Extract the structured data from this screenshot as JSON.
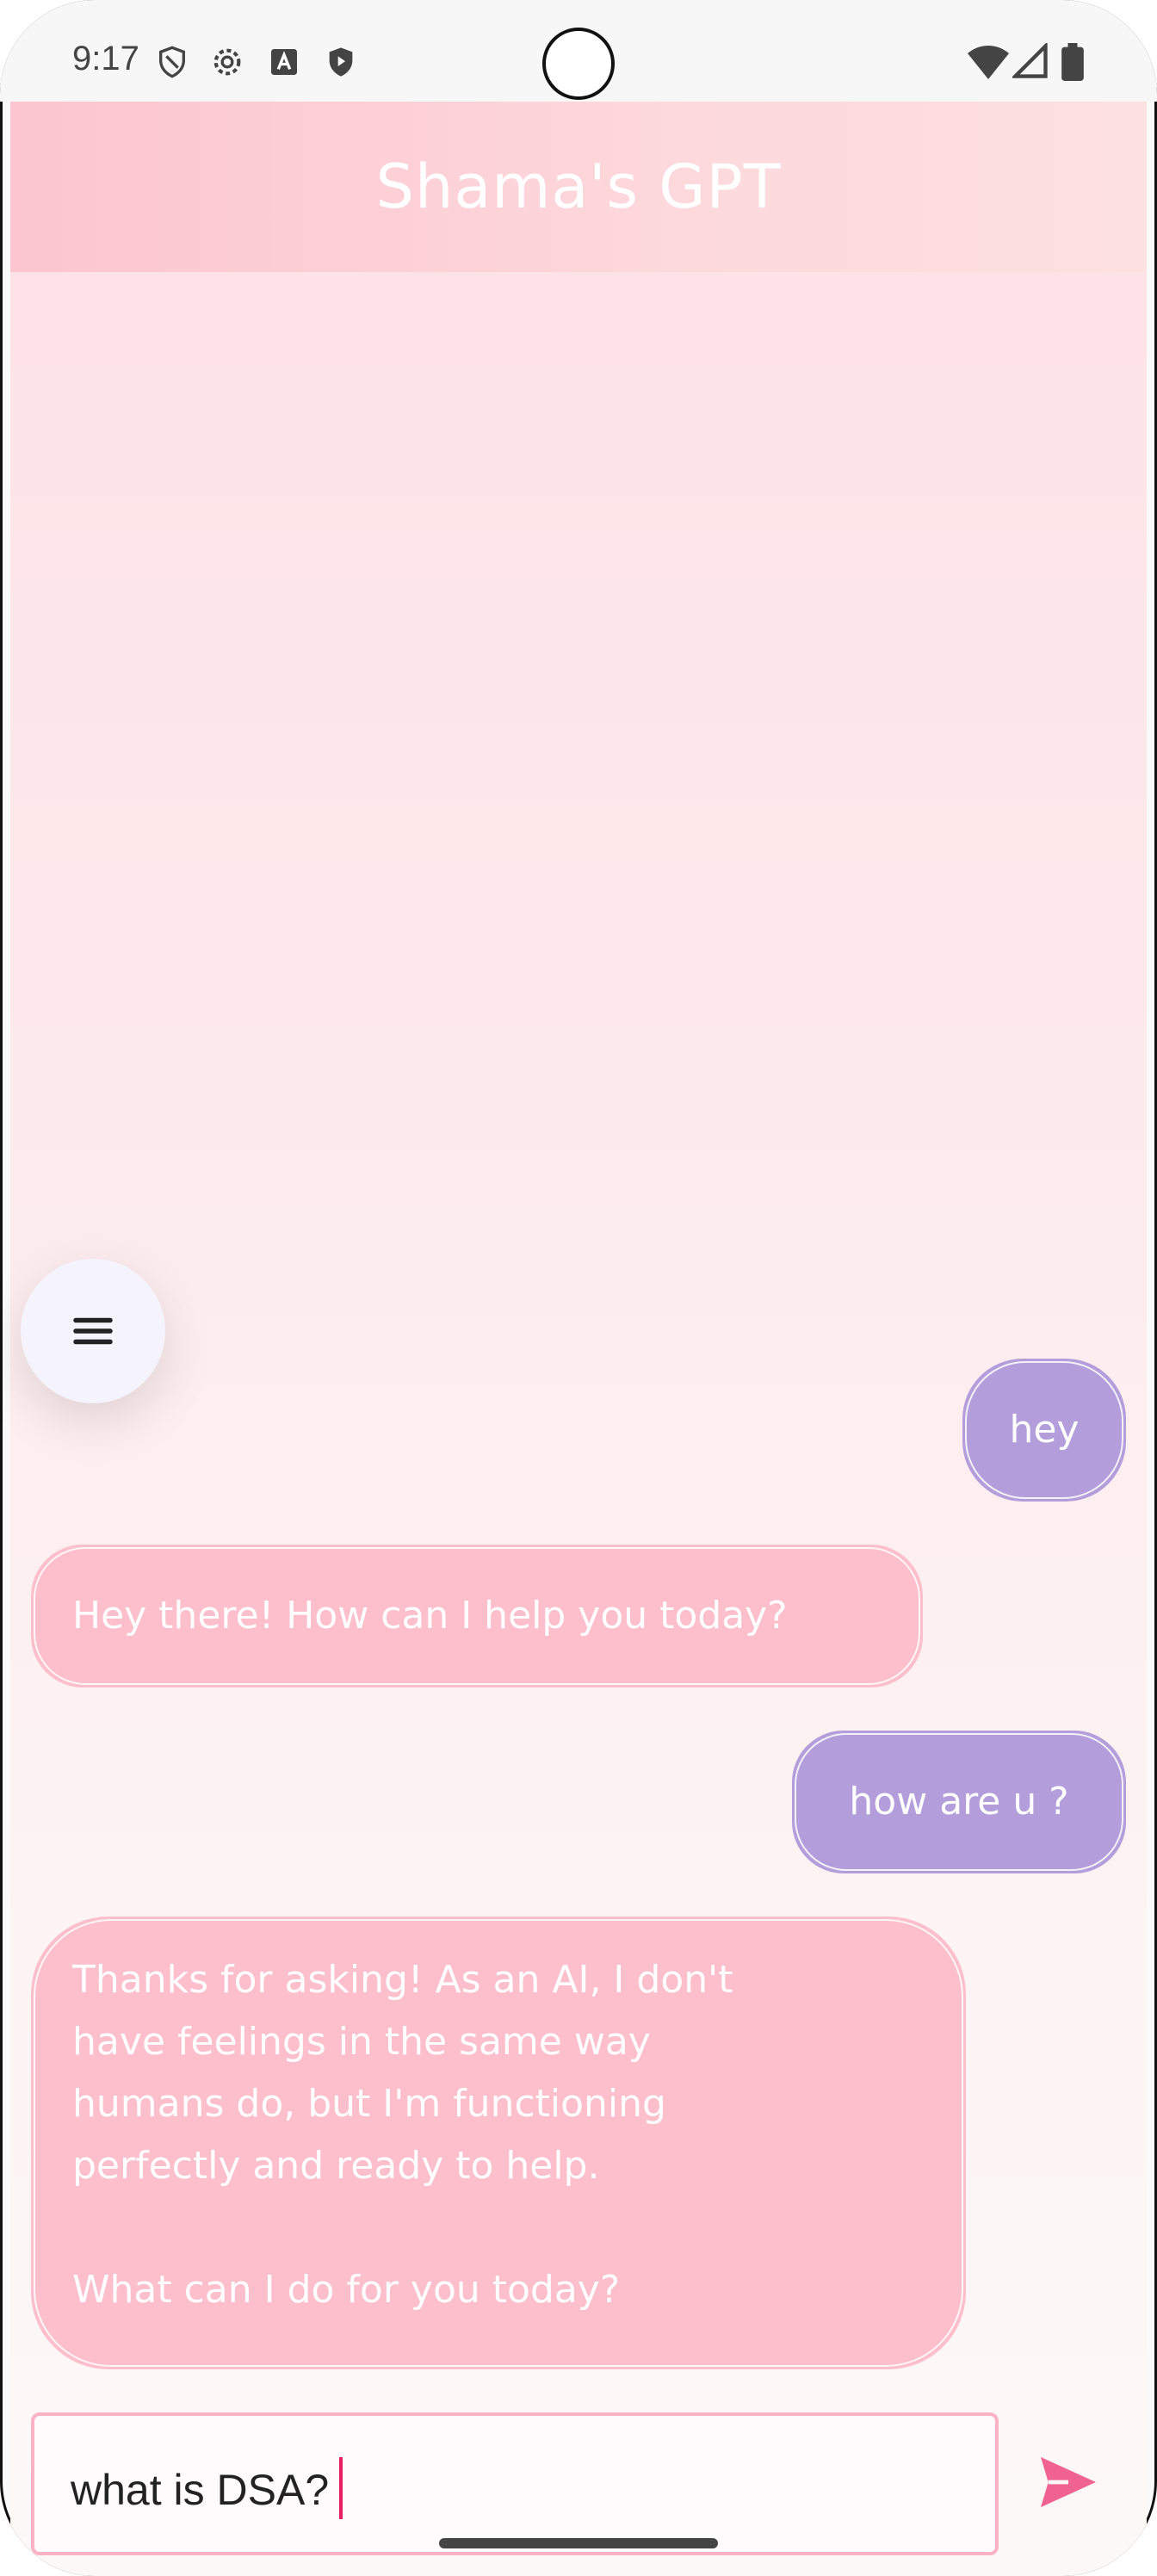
{
  "status_bar": {
    "time": "9:17",
    "left_icons": [
      "shield-icon",
      "gear-icon",
      "a-icon",
      "play-shield-icon"
    ],
    "right_icons": [
      "wifi-icon",
      "signal-icon",
      "battery-icon"
    ]
  },
  "header": {
    "title": "Shama's GPT"
  },
  "menu": {
    "icon": "menu-icon"
  },
  "messages": [
    {
      "role": "user",
      "text": "hey"
    },
    {
      "role": "bot",
      "text": "Hey there! How can I help you today?"
    },
    {
      "role": "user",
      "text": "how are u ?"
    },
    {
      "role": "bot",
      "text": "Thanks for asking! As an AI, I don't\nhave feelings in the same way\nhumans do, but I'm functioning\nperfectly and ready to help.\n\nWhat can I do for you today?"
    }
  ],
  "composer": {
    "value": "what is DSA?",
    "send_icon": "send-icon"
  },
  "colors": {
    "user_bubble": "#b39ddb",
    "bot_bubble": "#fdbfcc",
    "accent": "#f06292",
    "header": "#fcc5cf"
  }
}
